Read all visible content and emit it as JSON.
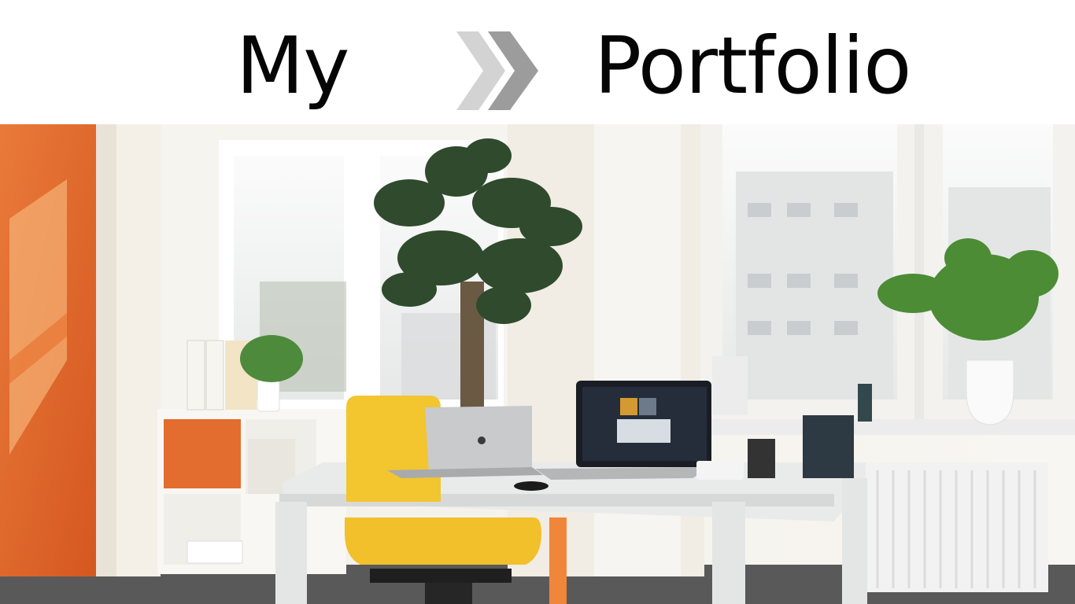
{
  "title": {
    "first_word": "My",
    "second_word": "Portfolio",
    "separator_icon": "double-chevron-right-icon"
  },
  "hero_image": {
    "subject": "office-workspace-photo"
  },
  "colors": {
    "heading": "#050505",
    "chevron_light": "#d3d3d3",
    "chevron_dark": "#9c9c9c",
    "accent_orange": "#e06a2c",
    "chair_yellow": "#f3c52e"
  }
}
